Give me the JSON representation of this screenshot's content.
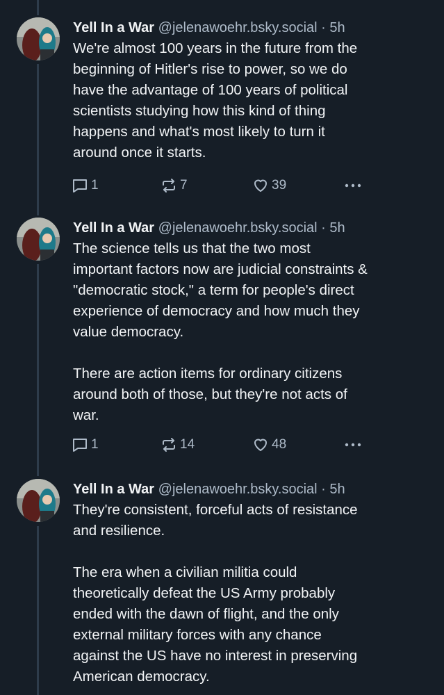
{
  "posts": [
    {
      "author": {
        "name": "Yell In a War",
        "handle": "@jelenawoehr.bsky.social",
        "time": "5h"
      },
      "separator": "·",
      "text": "We're almost 100 years in the future from the\nbeginning of Hitler's rise to power, so we do\nhave the advantage of 100 years of political\nscientists studying how this kind of thing\nhappens and what's most likely to turn it\naround once it starts.",
      "stats": {
        "replies": "1",
        "reposts": "7",
        "likes": "39"
      }
    },
    {
      "author": {
        "name": "Yell In a War",
        "handle": "@jelenawoehr.bsky.social",
        "time": "5h"
      },
      "separator": "·",
      "text": "The science tells us that the two most\nimportant factors now are judicial constraints &\n\"democratic stock,\" a term for people's direct\nexperience of democracy and how much they\nvalue democracy.\n\nThere are action items for ordinary citizens\naround both of those, but they're not acts of\nwar.",
      "stats": {
        "replies": "1",
        "reposts": "14",
        "likes": "48"
      }
    },
    {
      "author": {
        "name": "Yell In a War",
        "handle": "@jelenawoehr.bsky.social",
        "time": "5h"
      },
      "separator": "·",
      "text": "They're consistent, forceful acts of resistance\nand resilience.\n\nThe era when a civilian militia could\ntheoretically defeat the US Army probably\nended with the dawn of flight, and the only\nexternal military forces with any chance\nagainst the US have no interest in preserving\nAmerican democracy."
    }
  ],
  "icons": {
    "reply": "speech-bubble-icon",
    "repost": "repost-arrows-icon",
    "like": "heart-icon",
    "more": "ellipsis-icon"
  },
  "colors": {
    "background": "#161e27",
    "text": "#f1f3f5",
    "muted": "#aebbc9",
    "thread_line": "#2e3c4b"
  }
}
